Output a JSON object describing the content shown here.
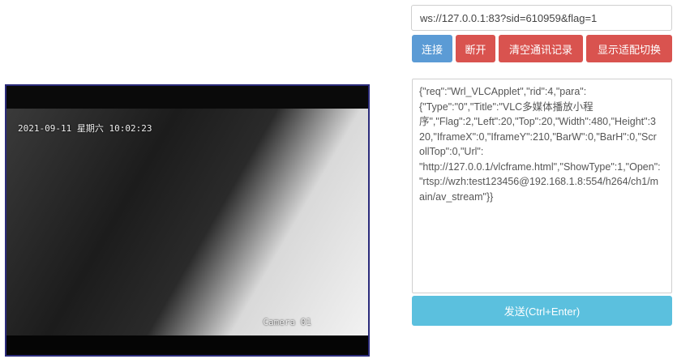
{
  "video": {
    "timestamp": "2021-09-11 星期六 10:02:23",
    "camera_label": "Camera 01"
  },
  "connection": {
    "url": "ws://127.0.0.1:83?sid=610959&flag=1"
  },
  "buttons": {
    "connect": "连接",
    "disconnect": "断开",
    "clear_log": "清空通讯记录",
    "toggle_adapt": "显示适配切换"
  },
  "message": {
    "content": "{\"req\":\"Wrl_VLCApplet\",\"rid\":4,\"para\":\n{\"Type\":\"0\",\"Title\":\"VLC多媒体播放小程\n序\",\"Flag\":2,\"Left\":20,\"Top\":20,\"Width\":480,\"Height\":3\n20,\"IframeX\":0,\"IframeY\":210,\"BarW\":0,\"BarH\":0,\"Scr\nollTop\":0,\"Url\":\n\"http://127.0.0.1/vlcframe.html\",\"ShowType\":1,\"Open\":\n\"rtsp://wzh:test123456@192.168.1.8:554/h264/ch1/m\nain/av_stream\"}}"
  },
  "send": {
    "label": "发送(Ctrl+Enter)"
  },
  "colors": {
    "primary": "#5b9bd5",
    "danger": "#d9534f",
    "info": "#5bc0de"
  }
}
